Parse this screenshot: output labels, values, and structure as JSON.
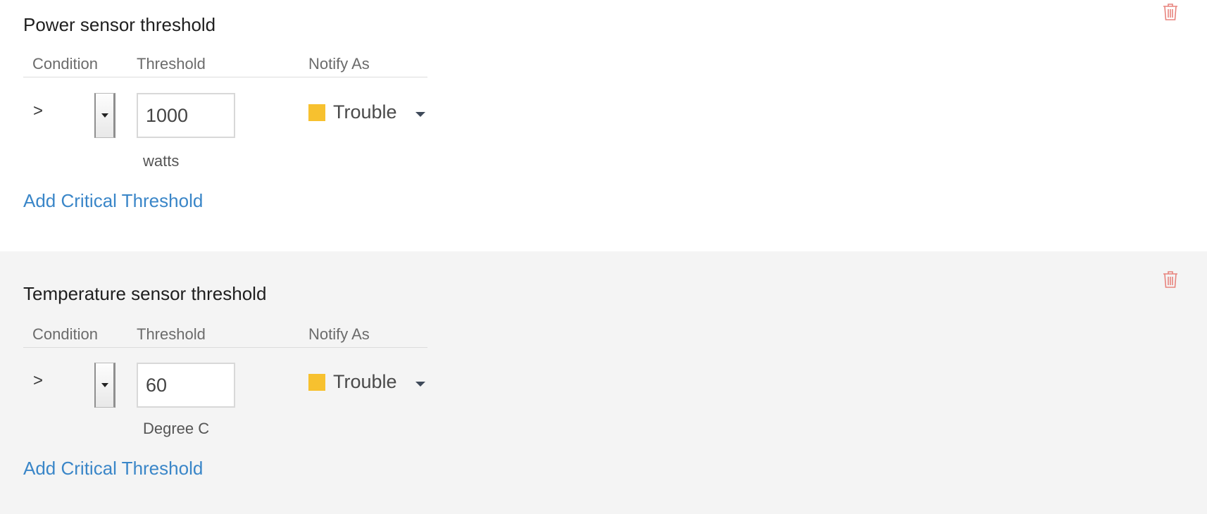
{
  "colors": {
    "trouble": "#f7c12f",
    "link": "#3a86c8",
    "delete": "#e8837d",
    "panel_alt_bg": "#f4f4f4"
  },
  "sections": [
    {
      "title": "Power sensor threshold",
      "headers": {
        "condition": "Condition",
        "threshold": "Threshold",
        "notify_as": "Notify As"
      },
      "condition_symbol": ">",
      "threshold_value": "1000",
      "unit": "watts",
      "notify_label": "Trouble",
      "notify_icon": "square-swatch",
      "add_link": "Add Critical Threshold",
      "delete_icon": "trash-icon"
    },
    {
      "title": "Temperature sensor threshold",
      "headers": {
        "condition": "Condition",
        "threshold": "Threshold",
        "notify_as": "Notify As"
      },
      "condition_symbol": ">",
      "threshold_value": "60",
      "unit": "Degree C",
      "notify_label": "Trouble",
      "notify_icon": "square-swatch",
      "add_link": "Add Critical Threshold",
      "delete_icon": "trash-icon"
    }
  ]
}
